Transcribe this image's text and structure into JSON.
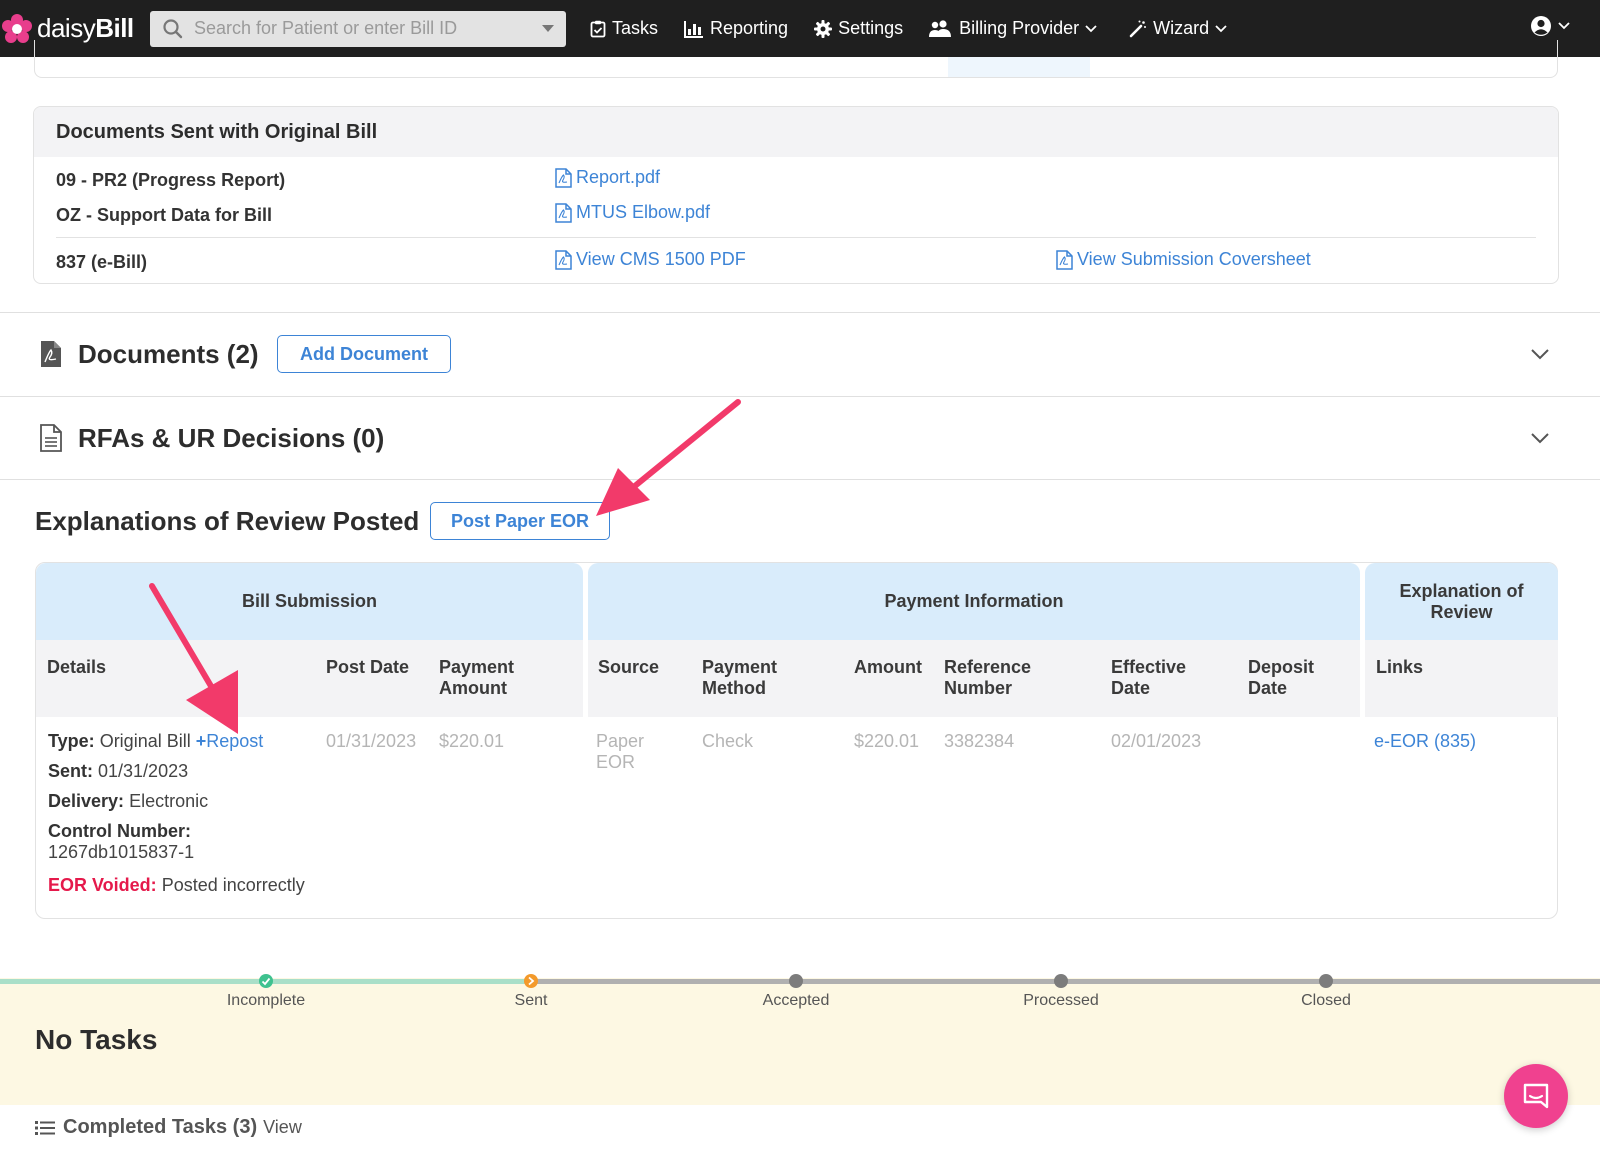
{
  "nav": {
    "logo_prefix": "daisy",
    "logo_suffix": "Bill",
    "search_placeholder": "Search for Patient or enter Bill ID",
    "items": [
      {
        "label": "Tasks",
        "icon": "clipboard-check-icon"
      },
      {
        "label": "Reporting",
        "icon": "bar-chart-icon"
      },
      {
        "label": "Settings",
        "icon": "gear-icon"
      },
      {
        "label": "Billing Provider",
        "icon": "users-icon"
      },
      {
        "label": "Wizard",
        "icon": "magic-wand-icon"
      }
    ]
  },
  "docs_sent": {
    "title": "Documents Sent with Original Bill",
    "rows": [
      {
        "label": "09 - PR2 (Progress Report)",
        "link": "Report.pdf"
      },
      {
        "label": "OZ - Support Data for Bill",
        "link": "MTUS Elbow.pdf"
      },
      {
        "label": "837 (e-Bill)",
        "link": "View CMS 1500 PDF",
        "link2": "View Submission Coversheet"
      }
    ]
  },
  "sections": {
    "documents_title": "Documents (2)",
    "add_document": "Add Document",
    "rfas_title": "RFAs & UR Decisions (0)"
  },
  "eor": {
    "title": "Explanations of Review Posted",
    "post_button": "Post Paper EOR",
    "groups": {
      "bill_submission": "Bill Submission",
      "payment_information": "Payment Information",
      "explanation_line1": "Explanation of",
      "explanation_line2": "Review"
    },
    "columns": {
      "details": "Details",
      "post_date": "Post Date",
      "payment_amount_1": "Payment",
      "payment_amount_2": "Amount",
      "source": "Source",
      "payment_method_1": "Payment",
      "payment_method_2": "Method",
      "amount": "Amount",
      "reference_number_1": "Reference",
      "reference_number_2": "Number",
      "effective_date_1": "Effective",
      "effective_date_2": "Date",
      "deposit_date_1": "Deposit",
      "deposit_date_2": "Date",
      "links": "Links"
    },
    "row": {
      "type_label": "Type:",
      "type_value": "Original Bill",
      "repost": "Repost",
      "sent_label": "Sent:",
      "sent_value": "01/31/2023",
      "delivery_label": "Delivery:",
      "delivery_value": "Electronic",
      "control_label": "Control Number:",
      "control_value": "1267db1015837-1",
      "voided_label": "EOR Voided:",
      "voided_value": "Posted incorrectly",
      "post_date": "01/31/2023",
      "payment_amount": "$220.01",
      "source_1": "Paper",
      "source_2": "EOR",
      "payment_method": "Check",
      "amount": "$220.01",
      "reference_number": "3382384",
      "effective_date": "02/01/2023",
      "deposit_date": "",
      "link": "e-EOR (835)"
    }
  },
  "timeline": {
    "steps": [
      "Incomplete",
      "Sent",
      "Accepted",
      "Processed",
      "Closed"
    ],
    "colors": {
      "done": "#3fc28f",
      "current": "#f39a2b",
      "pending": "#888888"
    }
  },
  "tasks": {
    "no_tasks": "No Tasks",
    "completed_label": "Completed Tasks (3)",
    "view": "View"
  }
}
